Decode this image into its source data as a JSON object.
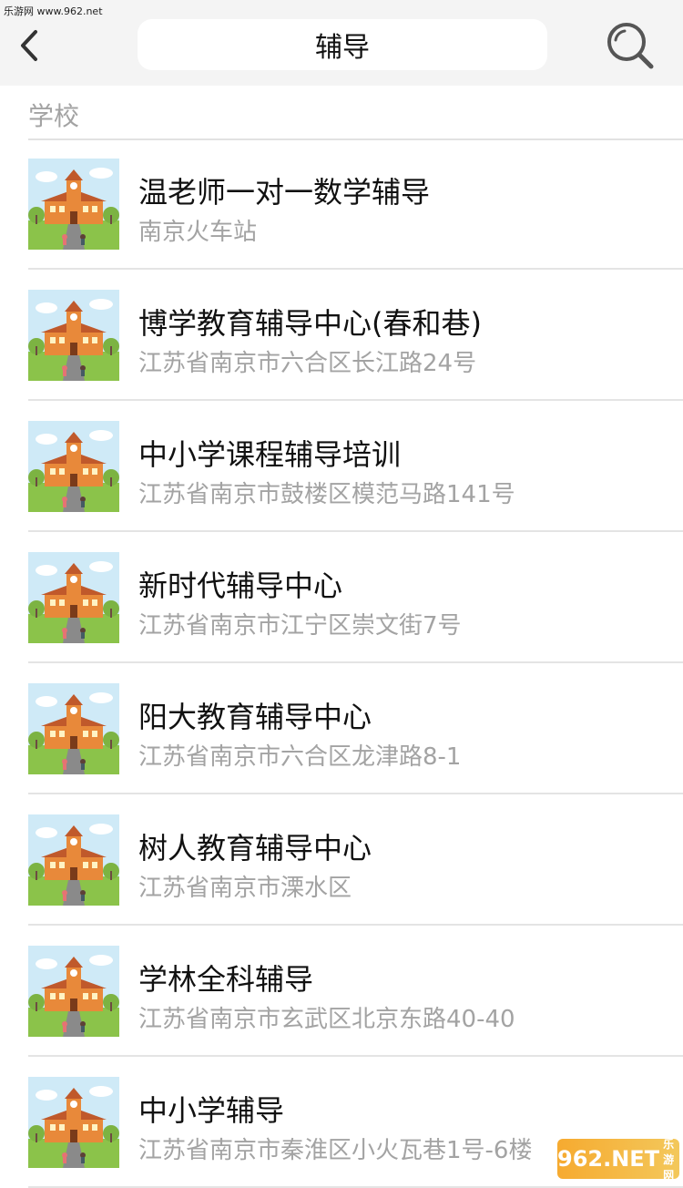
{
  "watermark_top": "乐游网 www.962.net",
  "header": {
    "title": "辅导",
    "back_icon": "chevron-left-icon",
    "search_icon": "search-icon"
  },
  "section": {
    "title": "学校"
  },
  "items": [
    {
      "name": "温老师一对一数学辅导",
      "address": "南京火车站"
    },
    {
      "name": "博学教育辅导中心(春和巷)",
      "address": "江苏省南京市六合区长江路24号"
    },
    {
      "name": "中小学课程辅导培训",
      "address": "江苏省南京市鼓楼区模范马路141号"
    },
    {
      "name": "新时代辅导中心",
      "address": "江苏省南京市江宁区崇文街7号"
    },
    {
      "name": "阳大教育辅导中心",
      "address": "江苏省南京市六合区龙津路8-1"
    },
    {
      "name": "树人教育辅导中心",
      "address": "江苏省南京市溧水区"
    },
    {
      "name": "学林全科辅导",
      "address": "江苏省南京市玄武区北京东路40-40"
    },
    {
      "name": "中小学辅导",
      "address": "江苏省南京市秦淮区小火瓦巷1号-6楼"
    }
  ],
  "watermark_bottom": {
    "brand": "962.NET",
    "sub": "乐游网"
  },
  "colors": {
    "header_bg": "#f4f4f4",
    "secondary_text": "#a3a3a3",
    "divider": "#e4e4e4"
  }
}
